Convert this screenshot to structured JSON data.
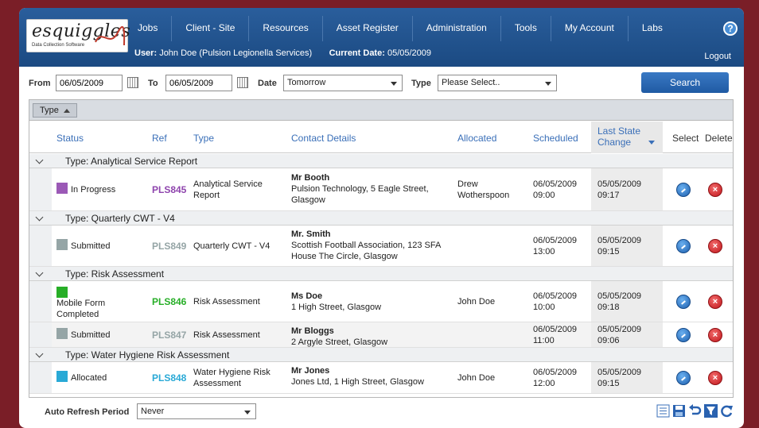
{
  "app": {
    "logo_text": "esquiggles",
    "logo_subtitle": "Data Collection Software"
  },
  "nav": {
    "items": [
      {
        "label": "Jobs"
      },
      {
        "label": "Client - Site"
      },
      {
        "label": "Resources"
      },
      {
        "label": "Asset Register"
      },
      {
        "label": "Administration"
      },
      {
        "label": "Tools"
      },
      {
        "label": "My Account"
      },
      {
        "label": "Labs"
      }
    ],
    "help_glyph": "?"
  },
  "userbar": {
    "user_label": "User:",
    "user_value": "John Doe (Pulsion Legionella Services)",
    "date_label": "Current Date:",
    "date_value": "05/05/2009",
    "logout": "Logout"
  },
  "filters": {
    "from_label": "From",
    "from_value": "06/05/2009",
    "to_label": "To",
    "to_value": "06/05/2009",
    "date_label": "Date",
    "date_value": "Tomorrow",
    "type_label": "Type",
    "type_value": "Please Select..",
    "search_label": "Search"
  },
  "grid": {
    "group_chip": "Type",
    "headers": {
      "status": "Status",
      "ref": "Ref",
      "type": "Type",
      "contact": "Contact Details",
      "allocated": "Allocated",
      "scheduled": "Scheduled",
      "last_state": "Last State Change",
      "select": "Select",
      "delete": "Delete"
    },
    "groups": [
      {
        "title": "Type: Analytical Service Report",
        "rows": [
          {
            "status": "In Progress",
            "status_color": "#9b59b6",
            "ref": "PLS845",
            "ref_color": "#8e44ad",
            "type": "Analytical Service Report",
            "contact_name": "Mr Booth",
            "contact_addr": "Pulsion Technology, 5 Eagle Street, Glasgow",
            "allocated": "Drew Wotherspoon",
            "scheduled_date": "06/05/2009",
            "scheduled_time": "09:00",
            "last_date": "05/05/2009",
            "last_time": "09:17"
          }
        ]
      },
      {
        "title": "Type: Quarterly CWT - V4",
        "rows": [
          {
            "status": "Submitted",
            "status_color": "#95a5a6",
            "ref": "PLS849",
            "ref_color": "#95a5a6",
            "type": "Quarterly CWT - V4",
            "contact_name": "Mr. Smith",
            "contact_addr": "Scottish Football Association, 123 SFA House The Circle, Glasgow",
            "allocated": "",
            "scheduled_date": "06/05/2009",
            "scheduled_time": "13:00",
            "last_date": "05/05/2009",
            "last_time": "09:15"
          }
        ]
      },
      {
        "title": "Type: Risk Assessment",
        "rows": [
          {
            "status": "Mobile Form Completed",
            "status_color": "#27ae27",
            "ref": "PLS846",
            "ref_color": "#27ae27",
            "type": "Risk Assessment",
            "contact_name": "Ms Doe",
            "contact_addr": "1 High Street, Glasgow",
            "allocated": "John Doe",
            "scheduled_date": "06/05/2009",
            "scheduled_time": "10:00",
            "last_date": "05/05/2009",
            "last_time": "09:18"
          },
          {
            "status": "Submitted",
            "status_color": "#95a5a6",
            "ref": "PLS847",
            "ref_color": "#95a5a6",
            "type": "Risk Assessment",
            "contact_name": "Mr Bloggs",
            "contact_addr": "2 Argyle Street, Glasgow",
            "allocated": "",
            "scheduled_date": "06/05/2009",
            "scheduled_time": "11:00",
            "last_date": "05/05/2009",
            "last_time": "09:06"
          }
        ]
      },
      {
        "title": "Type: Water Hygiene Risk Assessment",
        "rows": [
          {
            "status": "Allocated",
            "status_color": "#29a9d6",
            "ref": "PLS848",
            "ref_color": "#29a9d6",
            "type": "Water Hygiene Risk Assessment",
            "contact_name": "Mr Jones",
            "contact_addr": "Jones Ltd, 1 High Street, Glasgow",
            "allocated": "John Doe",
            "scheduled_date": "06/05/2009",
            "scheduled_time": "12:00",
            "last_date": "05/05/2009",
            "last_time": "09:15"
          }
        ]
      }
    ]
  },
  "footer": {
    "auto_refresh_label": "Auto Refresh Period",
    "auto_refresh_value": "Never",
    "tool_icons": [
      "list-view-icon",
      "save-icon",
      "undo-icon",
      "filter-icon",
      "refresh-icon"
    ]
  }
}
